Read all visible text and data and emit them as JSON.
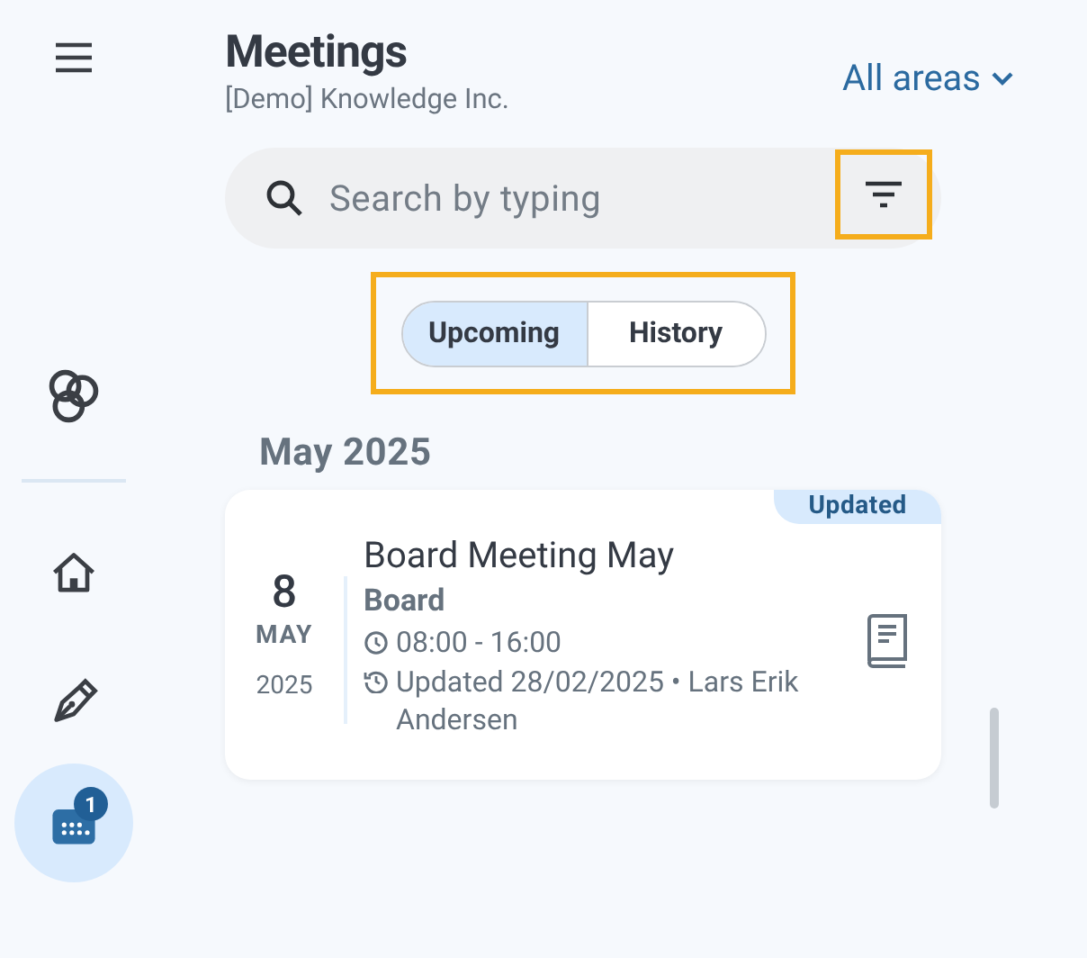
{
  "header": {
    "title": "Meetings",
    "subtitle": "[Demo] Knowledge Inc.",
    "area_selector": "All areas"
  },
  "sidebar": {
    "items": [
      {
        "kind": "home",
        "selected": false
      },
      {
        "kind": "pen",
        "selected": false
      },
      {
        "kind": "calendar",
        "selected": true,
        "badge": "1"
      }
    ]
  },
  "search": {
    "placeholder": "Search by typing",
    "filter_highlighted": true
  },
  "segments": {
    "highlighted": true,
    "items": [
      {
        "label": "Upcoming",
        "selected": true
      },
      {
        "label": "History",
        "selected": false
      }
    ]
  },
  "sections": [
    {
      "heading": "May 2025",
      "meetings": [
        {
          "badge": "Updated",
          "day": "8",
          "month": "MAY",
          "year": "2025",
          "title": "Board Meeting May",
          "group": "Board",
          "time": "08:00 - 16:00",
          "updated": "Updated 28/02/2025 • Lars Erik Andersen"
        }
      ]
    }
  ]
}
